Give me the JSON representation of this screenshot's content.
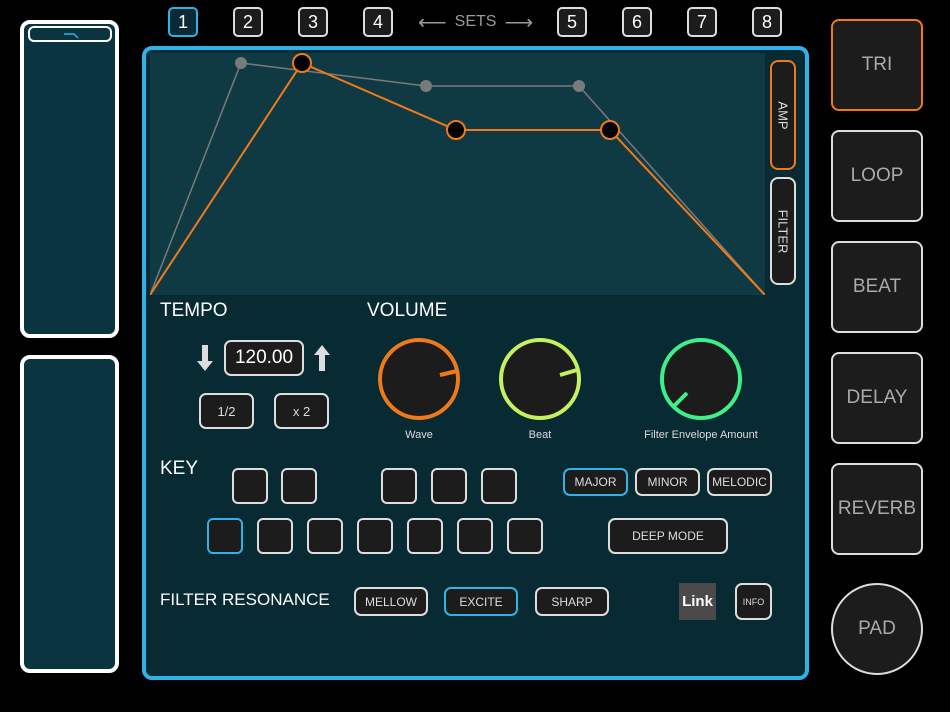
{
  "sets": {
    "buttons_left": [
      "1",
      "2",
      "3",
      "4"
    ],
    "buttons_right": [
      "5",
      "6",
      "7",
      "8"
    ],
    "label": "SETS",
    "arrow_left": "⟵",
    "arrow_right": "⟶",
    "active": "1"
  },
  "envelope_tabs": {
    "amp": "AMP",
    "filter": "FILTER",
    "active": "AMP"
  },
  "tempo": {
    "label": "TEMPO",
    "value": "120.00",
    "half": "1/2",
    "double": "x 2"
  },
  "volume": {
    "label": "VOLUME",
    "knobs": [
      {
        "name": "Wave",
        "color": "#f07a1a"
      },
      {
        "name": "Beat",
        "color": "#c6f060"
      },
      {
        "name": "Filter Envelope Amount",
        "color": "#3ef08a"
      }
    ]
  },
  "key": {
    "label": "KEY",
    "scales": [
      "MAJOR",
      "MINOR",
      "MELODIC"
    ],
    "selected_scale": "MAJOR",
    "deep_mode": "DEEP MODE"
  },
  "filter_resonance": {
    "label": "FILTER RESONANCE",
    "options": [
      "MELLOW",
      "EXCITE",
      "SHARP"
    ],
    "selected": "EXCITE"
  },
  "link_label": "Link",
  "info_label": "INFO",
  "presets": [
    "TRI",
    "LOOP",
    "BEAT",
    "DELAY",
    "REVERB"
  ],
  "active_preset": "TRI",
  "pad_label": "PAD",
  "colors": {
    "accent_blue": "#2fb3e6",
    "accent_orange": "#f07a1a",
    "panel_bg": "#082a33"
  }
}
